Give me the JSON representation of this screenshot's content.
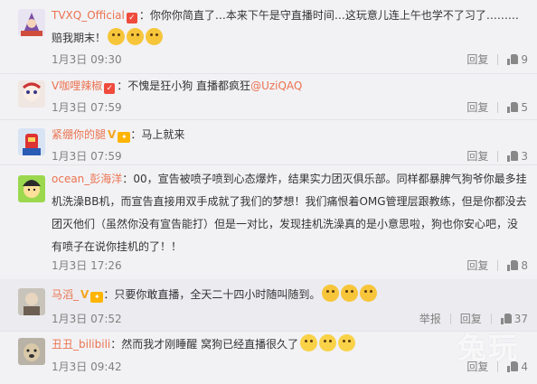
{
  "comments": [
    {
      "username": "TVXQ_Official",
      "text": "你你你简直了…本来下午是守直播时间…这玩意儿连上午也学不了习了………赔我期末！",
      "time": "1月3日 09:30",
      "reply": "回复",
      "likes": "9"
    },
    {
      "username": "V咖哩辣椒",
      "text": "不愧是狂小狗 直播都疯狂",
      "mention": "@UziQAQ",
      "time": "1月3日 07:59",
      "reply": "回复",
      "likes": "5"
    },
    {
      "username": "紧绷你的腿",
      "text": "马上就来",
      "time": "1月3日 07:59",
      "reply": "回复",
      "likes": "3"
    },
    {
      "username": "ocean_彭海洋",
      "text": "00，宣告被喷子喷到心态爆炸，结果实力团灭俱乐部。同样都暴脾气狗爷你最多挂机洗澡BB机，而宣告直接用双手成就了我们的梦想！我们痛恨着OMG管理层跟教练，但是你都没去团灭他们（虽然你没有宣告能打）但是一对比，发现挂机洗澡真的是小意思啦，狗也你安心吧，没有喷子在说你挂机的了！！",
      "time": "1月3日 17:26",
      "reply": "回复",
      "likes": "8"
    },
    {
      "username": "马滔_",
      "text": "只要你敢直播，全天二十四小时随叫随到。",
      "time": "1月3日 07:52",
      "report": "举报",
      "reply": "回复",
      "likes": "37"
    },
    {
      "username": "丑丑_bilibili",
      "text": "然而我才刚睡醒 窝狗已经直播很久了",
      "time": "1月3日 09:42",
      "reply": "回复",
      "likes": "4"
    }
  ],
  "watermark": "兔玩",
  "colors": {
    "username": "#eb7350",
    "meta": "#808080",
    "background": "#f2f2f5"
  },
  "icons": [
    "avatar",
    "vip-badge",
    "like-thumb-icon",
    "emoji-icon"
  ]
}
